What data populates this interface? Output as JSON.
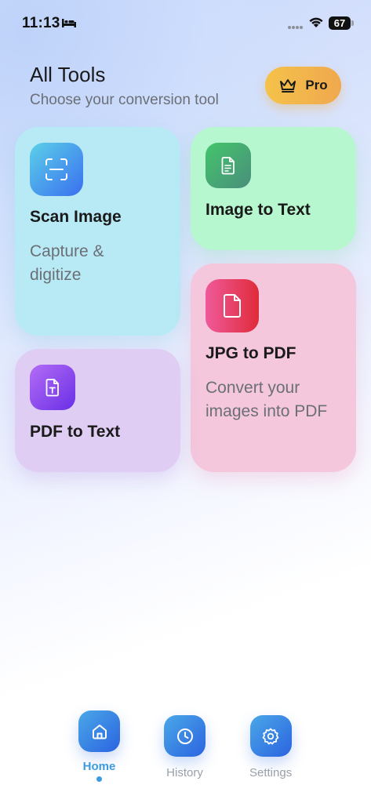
{
  "status_bar": {
    "time": "11:13",
    "battery": "67"
  },
  "header": {
    "title": "All Tools",
    "subtitle": "Choose your conversion tool",
    "pro_label": "Pro"
  },
  "tools": {
    "scan": {
      "title": "Scan Image",
      "description": "Capture & digitize",
      "icon": "scan-icon"
    },
    "image_to_text": {
      "title": "Image to Text",
      "icon": "document-text-icon"
    },
    "jpg_to_pdf": {
      "title": "JPG to PDF",
      "description": "Convert your images into PDF",
      "icon": "file-icon"
    },
    "pdf_to_text": {
      "title": "PDF to Text",
      "icon": "file-text-icon"
    }
  },
  "nav": {
    "home": "Home",
    "history": "History",
    "settings": "Settings",
    "active": "home"
  },
  "colors": {
    "accent": "#3b9be0",
    "pro_gradient": [
      "#f4c24a",
      "#f0a84e"
    ],
    "scan_card": "#b8eaf6",
    "image_to_text_card": "#b7f7cf",
    "jpg_to_pdf_card": "#f4c7dd",
    "pdf_to_text_card": "#e0cdf4"
  }
}
